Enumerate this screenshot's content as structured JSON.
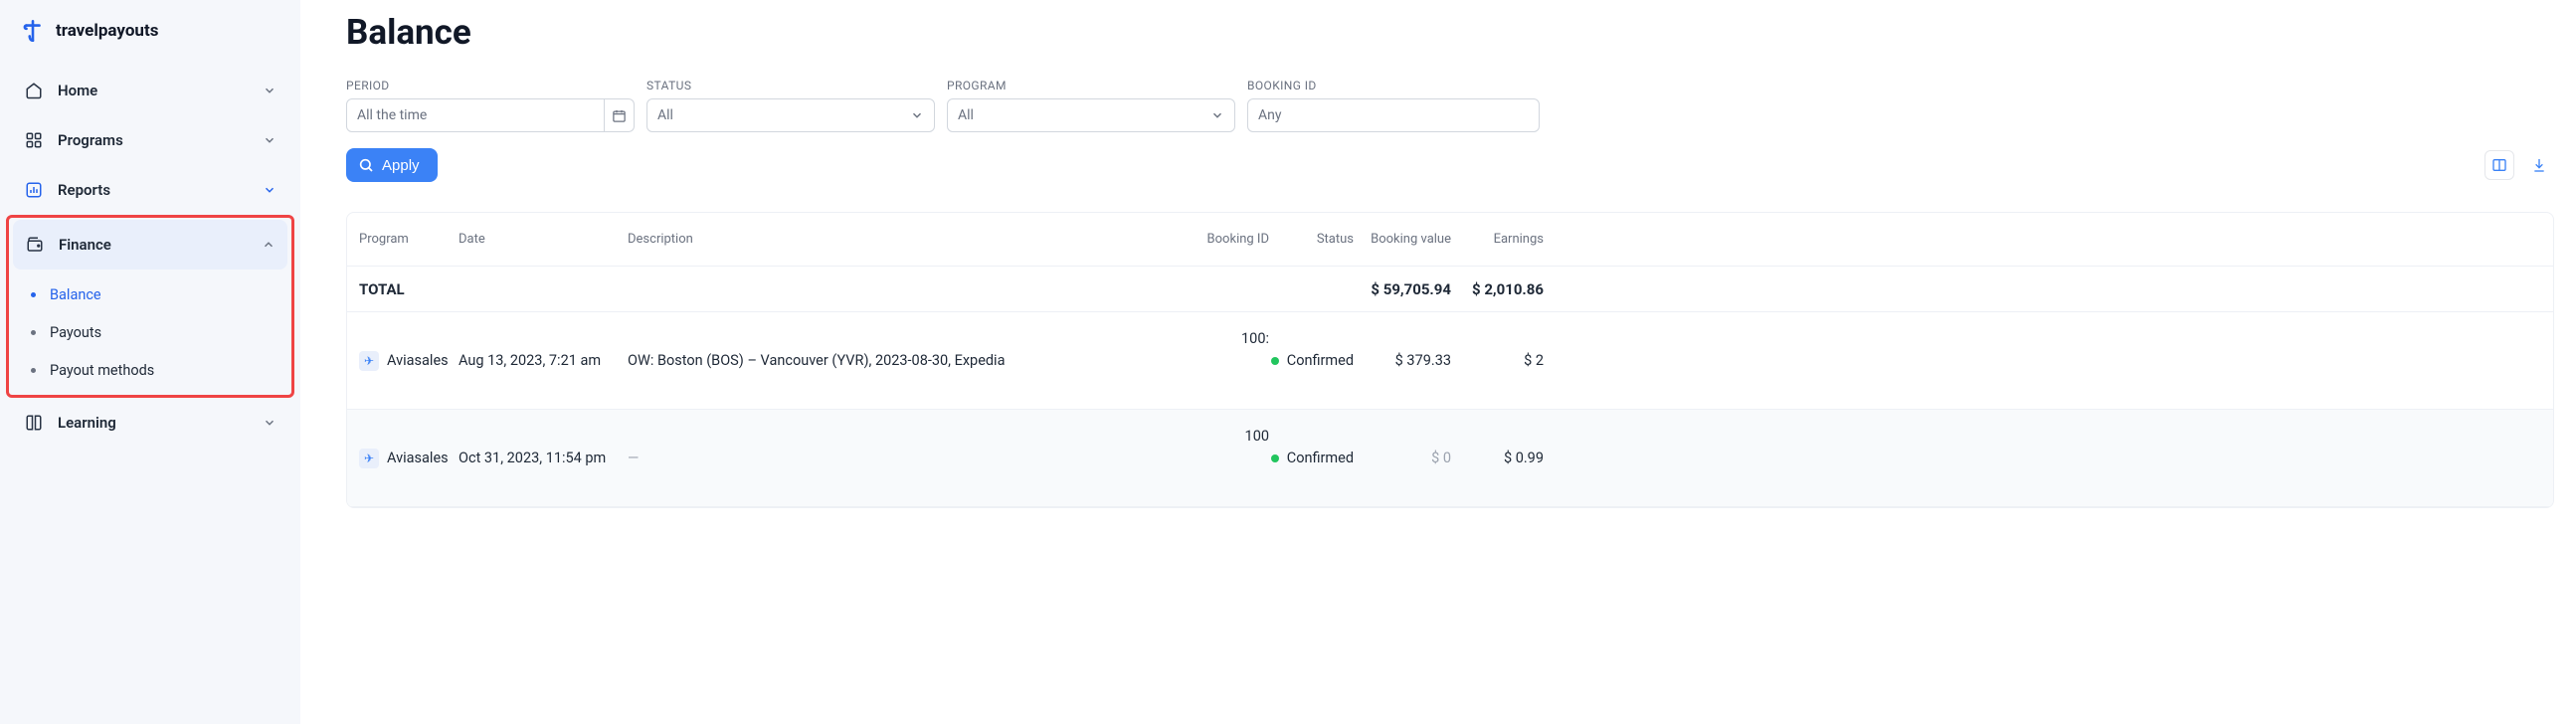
{
  "brand": {
    "name": "travelpayouts"
  },
  "sidebar": {
    "items": [
      {
        "label": "Home"
      },
      {
        "label": "Programs"
      },
      {
        "label": "Reports"
      },
      {
        "label": "Finance"
      },
      {
        "label": "Learning"
      }
    ],
    "finance_sub": [
      {
        "label": "Balance"
      },
      {
        "label": "Payouts"
      },
      {
        "label": "Payout methods"
      }
    ]
  },
  "page": {
    "title": "Balance"
  },
  "filters": {
    "period": {
      "label": "PERIOD",
      "placeholder": "All the time"
    },
    "status": {
      "label": "STATUS",
      "value": "All"
    },
    "program": {
      "label": "PROGRAM",
      "value": "All"
    },
    "booking": {
      "label": "BOOKING ID",
      "placeholder": "Any"
    },
    "apply_label": "Apply"
  },
  "table": {
    "headers": {
      "program": "Program",
      "date": "Date",
      "description": "Description",
      "booking_id": "Booking ID",
      "status": "Status",
      "booking_value": "Booking value",
      "earnings": "Earnings"
    },
    "total": {
      "label": "TOTAL",
      "booking_value": "$ 59,705.94",
      "earnings": "$ 2,010.86"
    },
    "rows": [
      {
        "program": "Aviasales",
        "date": "Aug 13, 2023, 7:21 am",
        "description": "OW: Boston (BOS) – Vancouver (YVR), 2023-08-30, Expedia",
        "booking_id": "100:",
        "status": "Confirmed",
        "booking_value": "$ 379.33",
        "earnings": "$ 2"
      },
      {
        "program": "Aviasales",
        "date": "Oct 31, 2023, 11:54 pm",
        "description": "—",
        "booking_id": "100",
        "status": "Confirmed",
        "booking_value": "$ 0",
        "earnings": "$ 0.99"
      }
    ]
  }
}
